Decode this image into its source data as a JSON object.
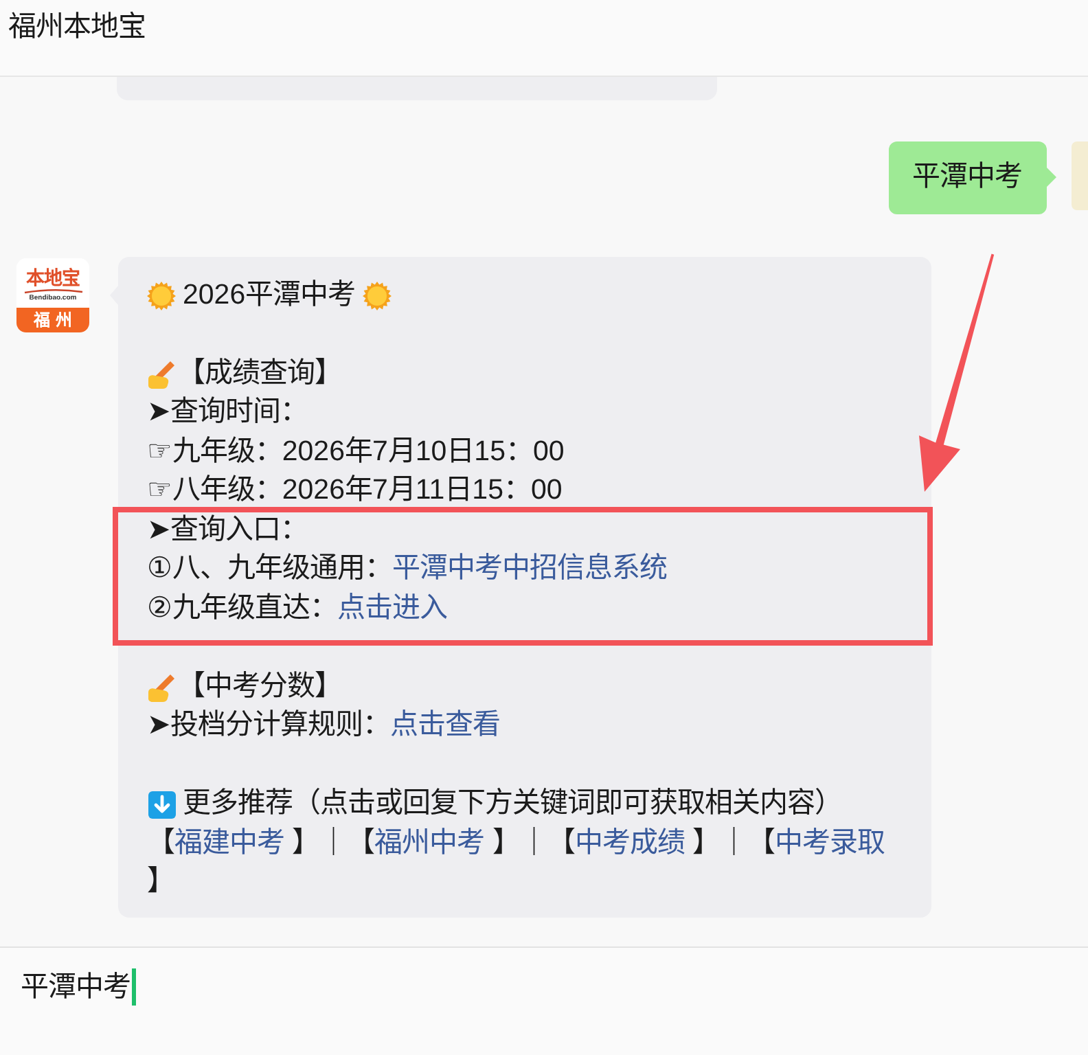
{
  "header": {
    "title": "福州本地宝"
  },
  "sent_message": {
    "text": "平潭中考"
  },
  "received_message": {
    "logo": {
      "brand": "本地宝",
      "domain": "Bendibao.com",
      "city": "福州"
    },
    "title": "2026平潭中考",
    "sections": [
      {
        "kind": "note",
        "heading": "【成绩查询】",
        "groups": [
          {
            "highlighted": false,
            "lines": [
              [
                {
                  "kind": "text",
                  "text": "➤查询时间："
                }
              ],
              [
                {
                  "kind": "text",
                  "text": "☞九年级：2026年7月10日15：00"
                }
              ],
              [
                {
                  "kind": "text",
                  "text": "☞八年级：2026年7月11日15：00"
                }
              ]
            ]
          },
          {
            "highlighted": true,
            "lines": [
              [
                {
                  "kind": "text",
                  "text": "➤查询入口："
                }
              ],
              [
                {
                  "kind": "text",
                  "text": "①八、九年级通用："
                },
                {
                  "kind": "link",
                  "text": "平潭中考中招信息系统"
                }
              ],
              [
                {
                  "kind": "text",
                  "text": "②九年级直达："
                },
                {
                  "kind": "link",
                  "text": "点击进入"
                }
              ]
            ]
          }
        ]
      },
      {
        "kind": "note",
        "heading": "【中考分数】",
        "groups": [
          {
            "highlighted": false,
            "lines": [
              [
                {
                  "kind": "text",
                  "text": "➤投档分计算规则："
                },
                {
                  "kind": "link",
                  "text": "点击查看"
                }
              ]
            ]
          }
        ]
      },
      {
        "kind": "recommend",
        "heading": "更多推荐（点击或回复下方关键词即可获取相关内容）",
        "groups": [
          {
            "highlighted": false,
            "lines": [
              [
                {
                  "kind": "text",
                  "text": "【"
                },
                {
                  "kind": "link",
                  "text": "福建中考"
                },
                {
                  "kind": "text",
                  "text": " 】｜【"
                },
                {
                  "kind": "link",
                  "text": "福州中考"
                },
                {
                  "kind": "text",
                  "text": " 】｜【"
                },
                {
                  "kind": "link",
                  "text": "中考成绩"
                },
                {
                  "kind": "text",
                  "text": " 】｜【"
                },
                {
                  "kind": "link",
                  "text": "中考录取"
                },
                {
                  "kind": "text",
                  "text": " 】"
                }
              ]
            ]
          }
        ]
      }
    ]
  },
  "input": {
    "value": "平潭中考"
  }
}
